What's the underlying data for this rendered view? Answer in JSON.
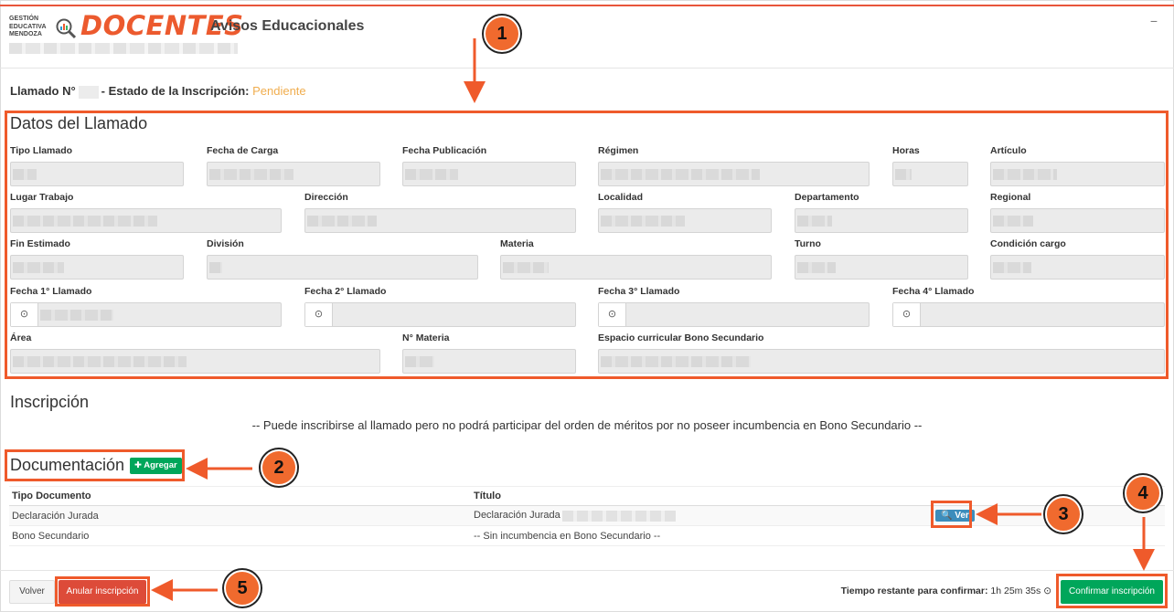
{
  "header": {
    "logo_lines": [
      "GESTIÓN",
      "EDUCATIVA",
      "MENDOZA"
    ],
    "brand": "DOCENTES",
    "title": "Avisos Educacionales",
    "collapse_symbol": "−"
  },
  "llamado": {
    "prefix": "Llamado N°",
    "estado_label": "- Estado de la Inscripción:",
    "estado_value": "Pendiente",
    "estado_color": "#f0ad4e"
  },
  "datos": {
    "title": "Datos del Llamado",
    "labels": {
      "tipo_llamado": "Tipo Llamado",
      "fecha_carga": "Fecha de Carga",
      "fecha_publicacion": "Fecha Publicación",
      "regimen": "Régimen",
      "horas": "Horas",
      "articulo": "Artículo",
      "lugar_trabajo": "Lugar Trabajo",
      "direccion": "Dirección",
      "localidad": "Localidad",
      "departamento": "Departamento",
      "regional": "Regional",
      "fin_estimado": "Fin Estimado",
      "division": "División",
      "materia": "Materia",
      "turno": "Turno",
      "condicion_cargo": "Condición cargo",
      "fecha1": "Fecha 1° Llamado",
      "fecha2": "Fecha 2° Llamado",
      "fecha3": "Fecha 3° Llamado",
      "fecha4": "Fecha 4° Llamado",
      "area": "Área",
      "n_materia": "N° Materia",
      "espacio": "Espacio curricular Bono Secundario"
    },
    "date_icon": "⊙"
  },
  "inscripcion": {
    "title": "Inscripción",
    "notice": "-- Puede inscribirse al llamado pero no podrá participar del orden de méritos por no poseer incumbencia en Bono Secundario --"
  },
  "documentacion": {
    "title": "Documentación",
    "add_button": "✚ Agregar",
    "columns": [
      "Tipo Documento",
      "Título"
    ],
    "rows": [
      {
        "tipo": "Declaración Jurada",
        "titulo": "Declaración Jurada",
        "action": "🔍 Ver"
      },
      {
        "tipo": "Bono Secundario",
        "titulo": "-- Sin incumbencia en Bono Secundario --",
        "action": ""
      }
    ]
  },
  "footer": {
    "volver": "Volver",
    "anular": "Anular inscripción",
    "timer_label": "Tiempo restante para confirmar:",
    "timer_value": "1h 25m 35s",
    "timer_icon": "⊙",
    "confirmar": "Confirmar inscripción"
  },
  "annotations": [
    "1",
    "2",
    "3",
    "4",
    "5"
  ],
  "colors": {
    "accent": "#ef5a2b",
    "success": "#00a65a",
    "danger": "#dd4b39",
    "info": "#3c8dbc"
  }
}
